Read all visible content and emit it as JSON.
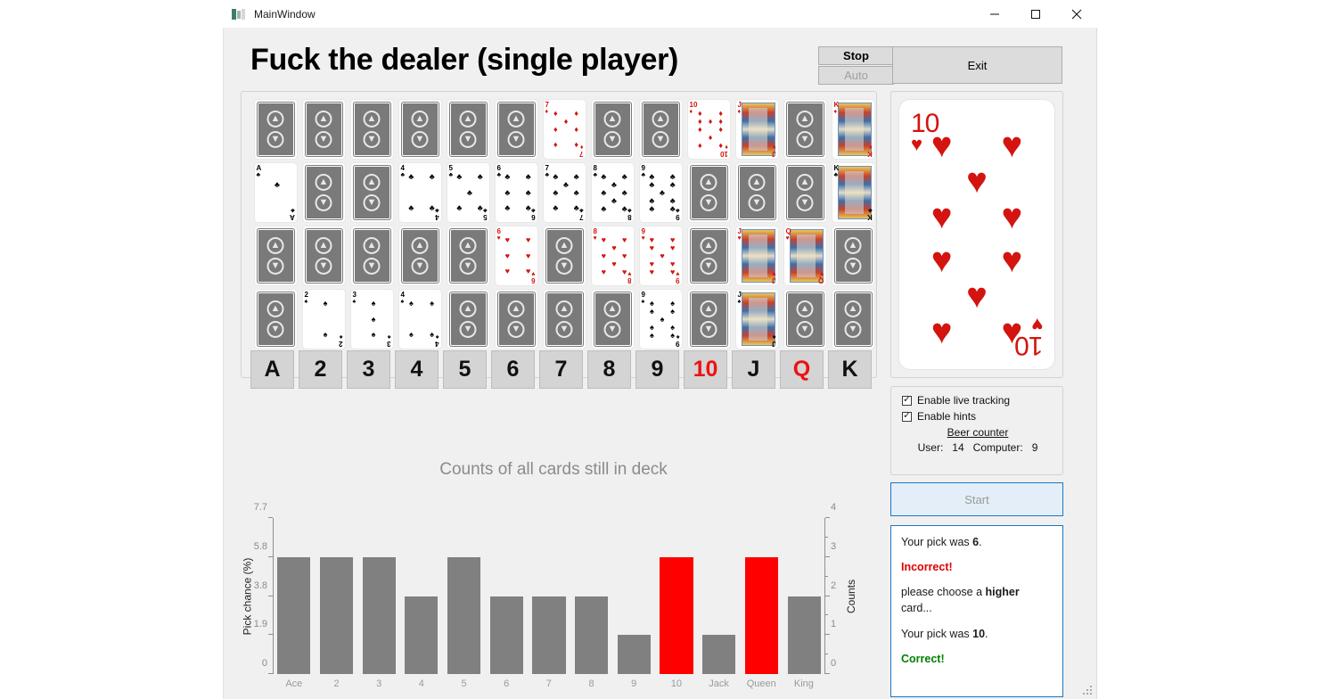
{
  "window": {
    "title": "MainWindow",
    "controls": [
      {
        "name": "minimize",
        "glyph": "—"
      },
      {
        "name": "maximize",
        "glyph": "□"
      },
      {
        "name": "close",
        "glyph": "✕"
      }
    ]
  },
  "app": {
    "title": "Fuck the dealer (single player)",
    "buttons": {
      "stop": "Stop",
      "auto": "Auto",
      "exit": "Exit",
      "start": "Start"
    }
  },
  "deck_grid": {
    "rows": [
      {
        "suit": "diamonds",
        "color": "#d3140f",
        "cards": [
          {
            "rank": "A",
            "faceup": false
          },
          {
            "rank": "2",
            "faceup": false
          },
          {
            "rank": "3",
            "faceup": false
          },
          {
            "rank": "4",
            "faceup": false
          },
          {
            "rank": "5",
            "faceup": false
          },
          {
            "rank": "6",
            "faceup": false
          },
          {
            "rank": "7",
            "faceup": true
          },
          {
            "rank": "8",
            "faceup": false
          },
          {
            "rank": "9",
            "faceup": false
          },
          {
            "rank": "10",
            "faceup": true
          },
          {
            "rank": "J",
            "faceup": true
          },
          {
            "rank": "Q",
            "faceup": false
          },
          {
            "rank": "K",
            "faceup": true
          }
        ]
      },
      {
        "suit": "clubs",
        "color": "#000000",
        "cards": [
          {
            "rank": "A",
            "faceup": true
          },
          {
            "rank": "2",
            "faceup": false
          },
          {
            "rank": "3",
            "faceup": false
          },
          {
            "rank": "4",
            "faceup": true
          },
          {
            "rank": "5",
            "faceup": true
          },
          {
            "rank": "6",
            "faceup": true
          },
          {
            "rank": "7",
            "faceup": true
          },
          {
            "rank": "8",
            "faceup": true
          },
          {
            "rank": "9",
            "faceup": true
          },
          {
            "rank": "10",
            "faceup": false
          },
          {
            "rank": "J",
            "faceup": false
          },
          {
            "rank": "Q",
            "faceup": false
          },
          {
            "rank": "K",
            "faceup": true
          }
        ]
      },
      {
        "suit": "hearts",
        "color": "#d3140f",
        "cards": [
          {
            "rank": "A",
            "faceup": false
          },
          {
            "rank": "2",
            "faceup": false
          },
          {
            "rank": "3",
            "faceup": false
          },
          {
            "rank": "4",
            "faceup": false
          },
          {
            "rank": "5",
            "faceup": false
          },
          {
            "rank": "6",
            "faceup": true
          },
          {
            "rank": "7",
            "faceup": false
          },
          {
            "rank": "8",
            "faceup": true
          },
          {
            "rank": "9",
            "faceup": true
          },
          {
            "rank": "10",
            "faceup": false
          },
          {
            "rank": "J",
            "faceup": true
          },
          {
            "rank": "Q",
            "faceup": true
          },
          {
            "rank": "K",
            "faceup": false
          }
        ]
      },
      {
        "suit": "spades",
        "color": "#000000",
        "cards": [
          {
            "rank": "A",
            "faceup": false
          },
          {
            "rank": "2",
            "faceup": true
          },
          {
            "rank": "3",
            "faceup": true
          },
          {
            "rank": "4",
            "faceup": true
          },
          {
            "rank": "5",
            "faceup": false
          },
          {
            "rank": "6",
            "faceup": false
          },
          {
            "rank": "7",
            "faceup": false
          },
          {
            "rank": "8",
            "faceup": false
          },
          {
            "rank": "9",
            "faceup": true
          },
          {
            "rank": "10",
            "faceup": false
          },
          {
            "rank": "J",
            "faceup": true
          },
          {
            "rank": "Q",
            "faceup": false
          },
          {
            "rank": "K",
            "faceup": false
          }
        ]
      }
    ]
  },
  "value_buttons": [
    {
      "label": "A",
      "highlighted": false
    },
    {
      "label": "2",
      "highlighted": false
    },
    {
      "label": "3",
      "highlighted": false
    },
    {
      "label": "4",
      "highlighted": false
    },
    {
      "label": "5",
      "highlighted": false
    },
    {
      "label": "6",
      "highlighted": false
    },
    {
      "label": "7",
      "highlighted": false
    },
    {
      "label": "8",
      "highlighted": false
    },
    {
      "label": "9",
      "highlighted": false
    },
    {
      "label": "10",
      "highlighted": true
    },
    {
      "label": "J",
      "highlighted": false
    },
    {
      "label": "Q",
      "highlighted": true
    },
    {
      "label": "K",
      "highlighted": false
    }
  ],
  "current_card": {
    "rank": "10",
    "suit": "hearts",
    "suit_glyph": "♥",
    "color": "#d3140f"
  },
  "options": {
    "live_tracking": {
      "label": "Enable live tracking",
      "checked": true
    },
    "hints": {
      "label": "Enable hints",
      "checked": true
    },
    "beer_counter_title": "Beer counter",
    "user_label": "User:",
    "user_value": "14",
    "computer_label": "Computer:",
    "computer_value": "9"
  },
  "hints": [
    {
      "type": "normal",
      "parts": [
        {
          "t": "Your pick was ",
          "b": false
        },
        {
          "t": "6",
          "b": true
        },
        {
          "t": ".",
          "b": false
        }
      ]
    },
    {
      "type": "bad",
      "parts": [
        {
          "t": "Incorrect!",
          "b": true
        }
      ]
    },
    {
      "type": "normal",
      "parts": [
        {
          "t": "please choose a ",
          "b": false
        },
        {
          "t": "higher",
          "b": true
        },
        {
          "t": " card...",
          "b": false
        }
      ]
    },
    {
      "type": "normal",
      "parts": [
        {
          "t": "Your pick was ",
          "b": false
        },
        {
          "t": "10",
          "b": true
        },
        {
          "t": ".",
          "b": false
        }
      ]
    },
    {
      "type": "good",
      "parts": [
        {
          "t": "Correct!",
          "b": true
        }
      ]
    }
  ],
  "chart_data": {
    "type": "bar",
    "title": "Counts of all cards still in deck",
    "xlabel": "",
    "ylabel": "Pick chance (%)",
    "ylabel_right": "Counts",
    "categories": [
      "Ace",
      "2",
      "3",
      "4",
      "5",
      "6",
      "7",
      "8",
      "9",
      "10",
      "Jack",
      "Queen",
      "King"
    ],
    "values": [
      3,
      3,
      3,
      2,
      3,
      2,
      2,
      2,
      1,
      3,
      1,
      3,
      2
    ],
    "percent_values": [
      5.8,
      5.8,
      5.8,
      3.8,
      5.8,
      3.8,
      3.8,
      3.8,
      1.9,
      5.8,
      1.9,
      5.8,
      3.8
    ],
    "highlighted": [
      false,
      false,
      false,
      false,
      false,
      false,
      false,
      false,
      false,
      true,
      false,
      true,
      false
    ],
    "bar_color": "#808080",
    "highlight_color": "#ff0000",
    "ylim": [
      0,
      4
    ],
    "ylim_left": [
      0,
      7.7
    ],
    "yticks_left": [
      "0",
      "1.9",
      "3.8",
      "5.8",
      "7.7"
    ],
    "yticks_right": [
      "0",
      "1",
      "2",
      "3",
      "4"
    ],
    "grid": false,
    "legend": false
  }
}
